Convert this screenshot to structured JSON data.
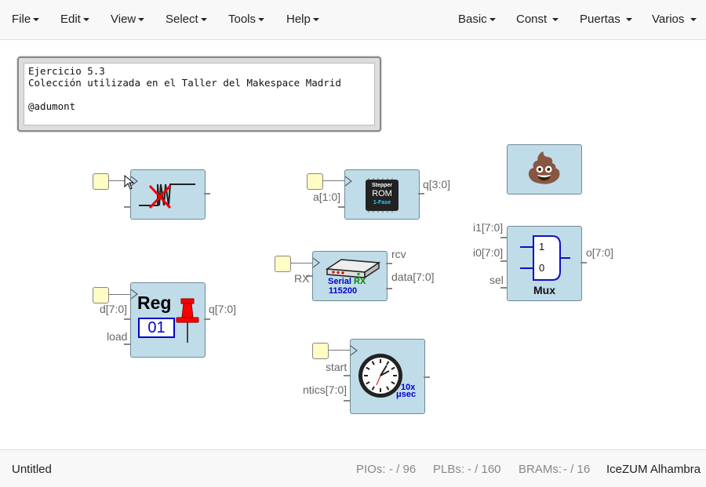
{
  "menu": {
    "file": "File",
    "edit": "Edit",
    "view": "View",
    "select": "Select",
    "tools": "Tools",
    "help": "Help",
    "basic": "Basic",
    "const": "Const",
    "puertas": "Puertas",
    "varios": "Varios"
  },
  "info_text": "Ejercicio 5.3\nColección utilizada en el Taller del Makespace Madrid\n\n@adumont",
  "blocks": {
    "stepper": {
      "out": "q[3:0]",
      "in": "a[1:0]",
      "chip_line1": "Stepper",
      "chip_line2": "ROM",
      "chip_line3": "1-Fase"
    },
    "serial": {
      "in": "RX",
      "out1": "rcv",
      "out2": "data[7:0]",
      "label1": "Serial",
      "label2": "RX",
      "baud": "115200"
    },
    "mux": {
      "in1": "i1[7:0]",
      "in0": "i0[7:0]",
      "sel": "sel",
      "out": "o[7:0]",
      "label": "Mux",
      "one": "1",
      "zero": "0"
    },
    "reg": {
      "in_d": "d[7:0]",
      "in_load": "load",
      "out": "q[7:0]",
      "title": "Reg",
      "value": "01"
    },
    "timer": {
      "in_start": "start",
      "in_ntics": "ntics[7:0]",
      "tag1": "10x",
      "tag2": "μsec"
    },
    "poop": {
      "emoji": "💩"
    }
  },
  "footer": {
    "name": "Untitled",
    "pios_label": "PIOs:",
    "pios_value": "- / 96",
    "plbs_label": "PLBs:",
    "plbs_value": "- / 160",
    "brams_label": "BRAMs:",
    "brams_value": "- / 16",
    "board": "IceZUM Alhambra"
  },
  "colors": {
    "block_fill": "#c0dce9",
    "pin_fill": "#fffcc4",
    "accent_blue": "#0000cc",
    "accent_green": "#008800"
  },
  "icons": [
    "debounce-icon",
    "chip-icon",
    "serial-device-icon",
    "mux-symbol-icon",
    "pushpin-icon",
    "clock-icon",
    "poop-emoji-icon",
    "cursor-icon"
  ]
}
